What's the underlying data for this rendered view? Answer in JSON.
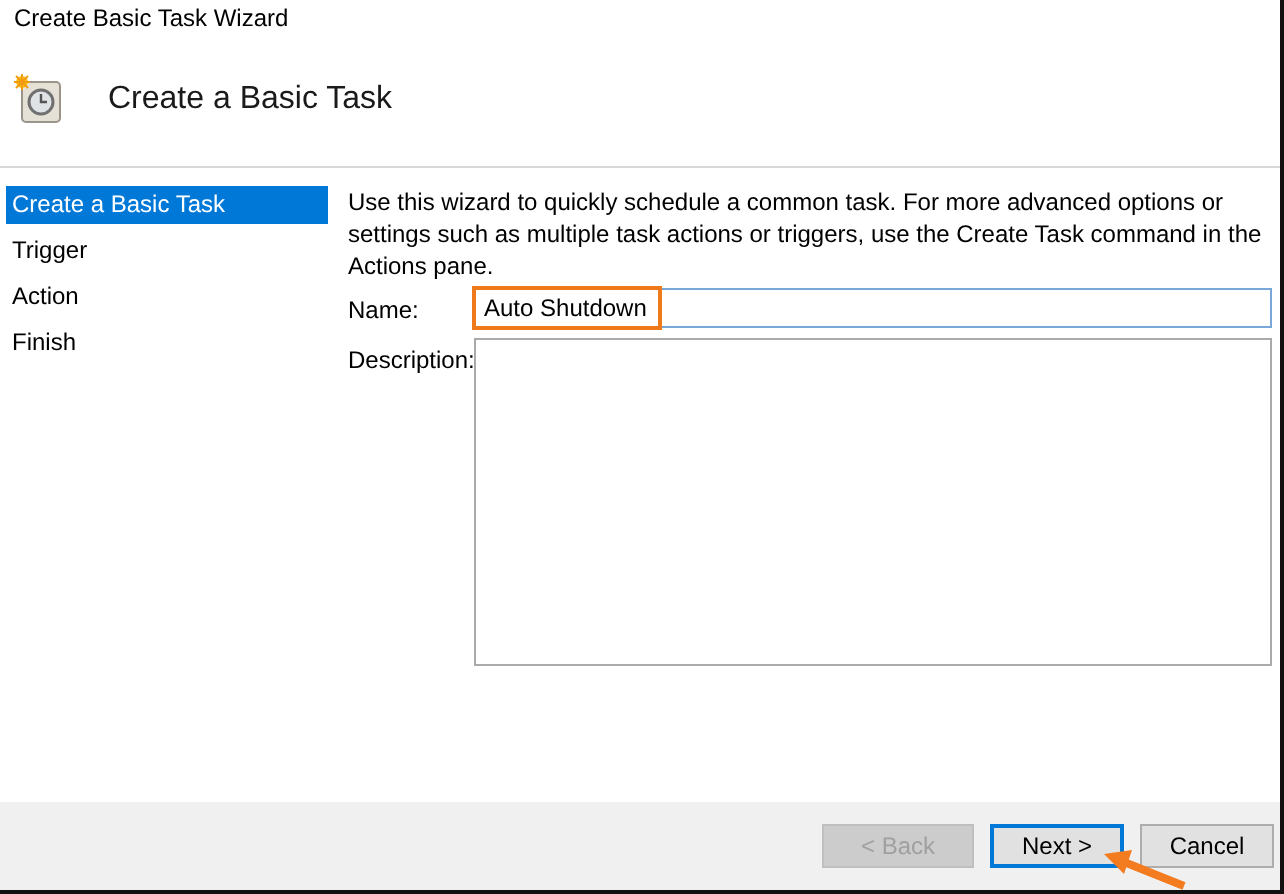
{
  "window": {
    "title": "Create Basic Task Wizard"
  },
  "header": {
    "title": "Create a Basic Task"
  },
  "steps": [
    {
      "label": "Create a Basic Task",
      "selected": true
    },
    {
      "label": "Trigger",
      "selected": false
    },
    {
      "label": "Action",
      "selected": false
    },
    {
      "label": "Finish",
      "selected": false
    }
  ],
  "intro": "Use this wizard to quickly schedule a common task.  For more advanced options or settings such as multiple task actions or triggers, use the Create Task command in the Actions pane.",
  "name_field": {
    "label": "Name:",
    "value": "Auto Shutdown",
    "highlighted": true
  },
  "description_field": {
    "label": "Description:"
  },
  "buttons": [
    {
      "label": "< Back",
      "disabled": true,
      "default": false
    },
    {
      "label": "Next >",
      "disabled": false,
      "default": true
    },
    {
      "label": "Cancel",
      "disabled": false,
      "default": false
    }
  ]
}
